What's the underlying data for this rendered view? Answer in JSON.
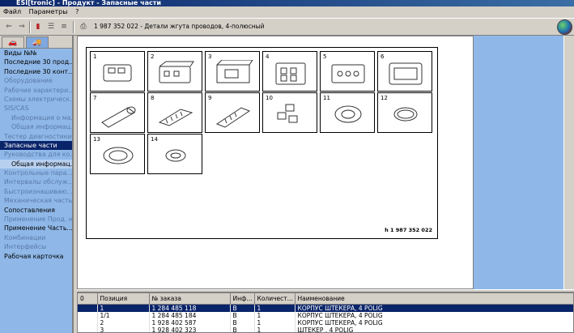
{
  "window": {
    "title": "ESI[tronic] - Продукт - Запасные части"
  },
  "menu": {
    "file": "Файл",
    "params": "Параметры",
    "help": "?"
  },
  "toolbar": {
    "part_title": "1 987 352 022 - Детали жгута проводов, 4-полюсный"
  },
  "sidebar": {
    "items": [
      {
        "label": "Виды №№",
        "state": "normal"
      },
      {
        "label": "Последние 30 прод...",
        "state": "normal"
      },
      {
        "label": "Последние 30 конт...",
        "state": "normal"
      },
      {
        "label": "Оборудование",
        "state": "disabled"
      },
      {
        "label": "Рабочие характери...",
        "state": "disabled"
      },
      {
        "label": "Схемы электрическ...",
        "state": "disabled"
      },
      {
        "label": "SIS/CAS",
        "state": "disabled"
      },
      {
        "label": "Информация о ма...",
        "state": "disabled-indent"
      },
      {
        "label": "Общая информац...",
        "state": "disabled-indent"
      },
      {
        "label": "Тестер диагностики",
        "state": "disabled"
      },
      {
        "label": "Запасные части",
        "state": "selected"
      },
      {
        "label": "Руководства для ко...",
        "state": "disabled"
      },
      {
        "label": "Общая информац...",
        "state": "indent"
      },
      {
        "label": "Контрольные пара...",
        "state": "disabled"
      },
      {
        "label": "Интервалы обслуж...",
        "state": "disabled"
      },
      {
        "label": "Быстроизнашиваю...",
        "state": "disabled"
      },
      {
        "label": "Механическая часть",
        "state": "disabled"
      },
      {
        "label": "Сопоставления",
        "state": "normal"
      },
      {
        "label": "Применение Прод. н...",
        "state": "disabled"
      },
      {
        "label": "Применение Часть...",
        "state": "normal"
      },
      {
        "label": "Комбинации",
        "state": "disabled"
      },
      {
        "label": "Интерфейсы",
        "state": "disabled"
      },
      {
        "label": "Рабочая карточка",
        "state": "normal"
      }
    ]
  },
  "drawing": {
    "cells": [
      "1",
      "2",
      "3",
      "4",
      "5",
      "6",
      "7",
      "8",
      "9",
      "10",
      "11",
      "12",
      "13",
      "14"
    ],
    "part_number": "h 1 987 352 022"
  },
  "table": {
    "headers": [
      "0",
      "Позиция",
      "№ заказа",
      "Инф...",
      "Количест...",
      "Наименование"
    ],
    "rows": [
      [
        "",
        "1",
        "1 284 485 118",
        "B",
        "1",
        "КОРПУС ШТЕКЕРА, 4 POLIG"
      ],
      [
        "",
        "1/1",
        "1 284 485 184",
        "B",
        "1",
        "КОРПУС ШТЕКЕРА, 4 POLIG"
      ],
      [
        "",
        "2",
        "1 928 402 587",
        "B",
        "1",
        "КОРПУС ШТЕКЕРА, 4 POLIG"
      ],
      [
        "",
        "3",
        "1 928 402 323",
        "B",
        "1",
        "ШТЕКЕР , 4 POLIG"
      ]
    ]
  },
  "colors": {
    "selection": "#0a246a",
    "sidebar_bg": "#8fb8e8"
  }
}
